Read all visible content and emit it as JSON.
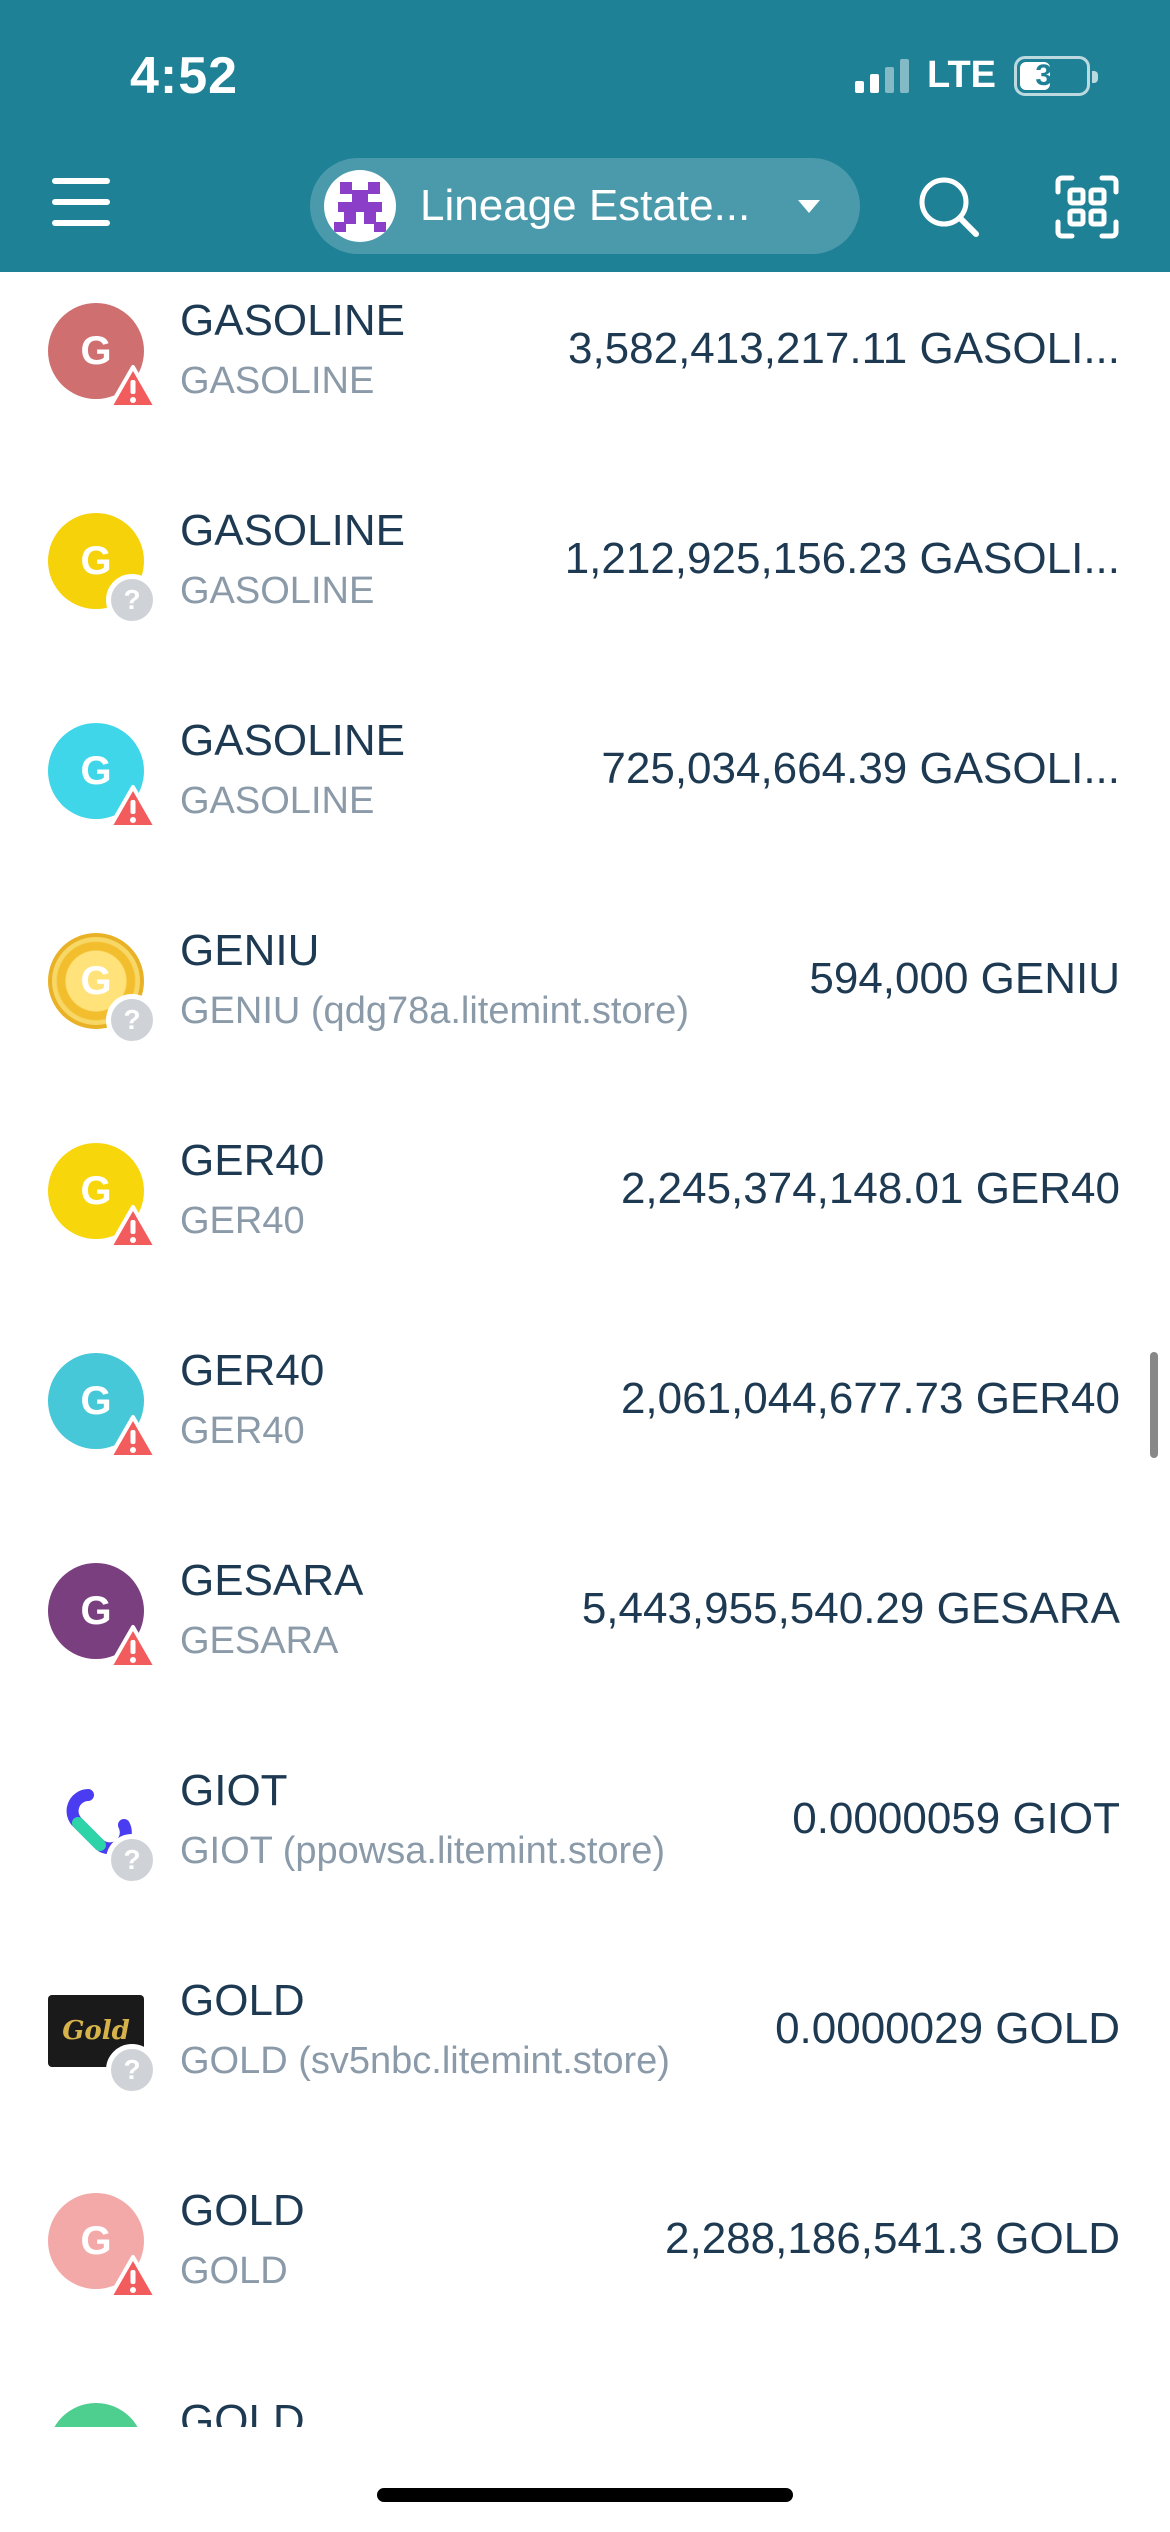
{
  "status_bar": {
    "time": "4:52",
    "network": "LTE",
    "battery": "35"
  },
  "header": {
    "account_name": "Lineage Estate...",
    "colors": {
      "background": "#1e8196"
    }
  },
  "tokens": [
    {
      "title": "GASOLINE",
      "subtitle": "GASOLINE",
      "amount": "3,582,413,217.11 GASOLI...",
      "icon_letter": "G",
      "icon_color": "#cf6f6f",
      "badge": "warning"
    },
    {
      "title": "GASOLINE",
      "subtitle": "GASOLINE",
      "amount": "1,212,925,156.23 GASOLI...",
      "icon_letter": "G",
      "icon_color": "#f5d20a",
      "badge": "unknown"
    },
    {
      "title": "GASOLINE",
      "subtitle": "GASOLINE",
      "amount": "725,034,664.39 GASOLI...",
      "icon_letter": "G",
      "icon_color": "#3ed6e8",
      "badge": "warning"
    },
    {
      "title": "GENIU",
      "subtitle": "GENIU (qdg78a.litemint.store)",
      "amount": "594,000 GENIU",
      "icon_letter": "G",
      "icon_color": "#f4c842",
      "badge": "unknown",
      "icon_style": "coin"
    },
    {
      "title": "GER40",
      "subtitle": "GER40",
      "amount": "2,245,374,148.01 GER40",
      "icon_letter": "G",
      "icon_color": "#f7d60c",
      "badge": "warning"
    },
    {
      "title": "GER40",
      "subtitle": "GER40",
      "amount": "2,061,044,677.73 GER40",
      "icon_letter": "G",
      "icon_color": "#46c8d8",
      "badge": "warning"
    },
    {
      "title": "GESARA",
      "subtitle": "GESARA",
      "amount": "5,443,955,540.29 GESARA",
      "icon_letter": "G",
      "icon_color": "#7a3f7e",
      "badge": "warning"
    },
    {
      "title": "GIOT",
      "subtitle": "GIOT (ppowsa.litemint.store)",
      "amount": "0.0000059 GIOT",
      "icon_letter": "",
      "icon_color": "#ffffff",
      "badge": "unknown",
      "icon_style": "giot"
    },
    {
      "title": "GOLD",
      "subtitle": "GOLD (sv5nbc.litemint.store)",
      "amount": "0.0000029 GOLD",
      "icon_letter": "",
      "icon_color": "#1a1a1a",
      "badge": "unknown",
      "icon_style": "gold-logo"
    },
    {
      "title": "GOLD",
      "subtitle": "GOLD",
      "amount": "2,288,186,541.3 GOLD",
      "icon_letter": "G",
      "icon_color": "#f4a9a9",
      "badge": "warning"
    },
    {
      "title": "GOLD",
      "subtitle": "",
      "amount": "",
      "icon_letter": "",
      "icon_color": "#4fcf8f",
      "badge": "none"
    }
  ]
}
